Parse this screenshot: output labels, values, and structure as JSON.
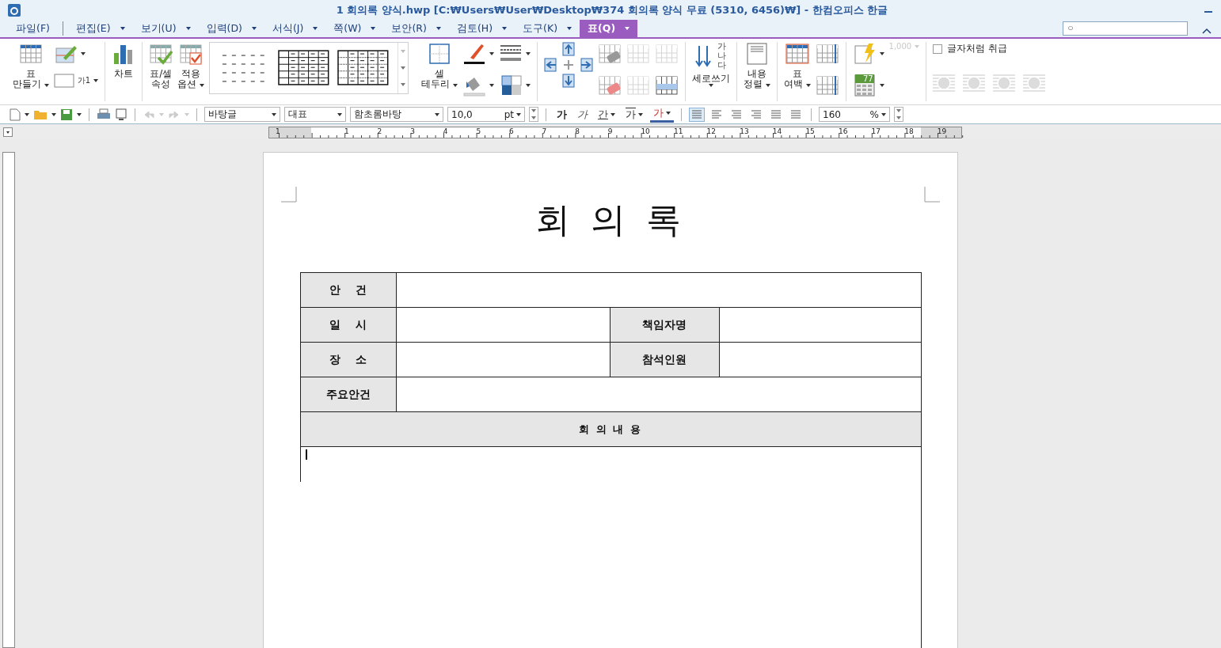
{
  "window": {
    "title": "1 회의록 양식.hwp [C:₩Users₩User₩Desktop₩374 회의록 양식 무료 (5310, 6456)₩] - 한컴오피스 한글"
  },
  "menu": [
    {
      "label": "파일(F)",
      "selected": false,
      "dropdown": false
    },
    {
      "label": "편집(E)",
      "selected": false,
      "dropdown": true
    },
    {
      "label": "보기(U)",
      "selected": false,
      "dropdown": true
    },
    {
      "label": "입력(D)",
      "selected": false,
      "dropdown": true
    },
    {
      "label": "서식(J)",
      "selected": false,
      "dropdown": true
    },
    {
      "label": "쪽(W)",
      "selected": false,
      "dropdown": true
    },
    {
      "label": "보안(R)",
      "selected": false,
      "dropdown": true
    },
    {
      "label": "검토(H)",
      "selected": false,
      "dropdown": true
    },
    {
      "label": "도구(K)",
      "selected": false,
      "dropdown": true
    },
    {
      "label": "표(Q)",
      "selected": true,
      "dropdown": true
    }
  ],
  "search": {
    "value": "ㅇ"
  },
  "ribbon": {
    "make_table": [
      "표",
      "만들기"
    ],
    "caption_box": "가1",
    "chart": [
      "차트"
    ],
    "cell_props": [
      "표/셀",
      "속성"
    ],
    "apply_options": [
      "적용",
      "옵션"
    ],
    "cell_border": [
      "셀",
      "테두리"
    ],
    "vertical_writing": [
      "세로쓰기"
    ],
    "vertical_icon_text": "가나다",
    "content_align": [
      "내용",
      "정렬"
    ],
    "table_margin": [
      "표",
      "여백"
    ],
    "number_format": {
      "label": "1,000",
      "disabled": true
    },
    "calc_icon_text": "77",
    "treat_as_char": {
      "label": "글자처럼 취급",
      "checked": false
    }
  },
  "toolbar": {
    "style": "바탕글",
    "style_kind": "대표",
    "font": "함초롬바탕",
    "size": "10,0",
    "unit": "pt",
    "char_buttons": [
      {
        "label": "가",
        "kind": "bold"
      },
      {
        "label": "가",
        "kind": "italic"
      },
      {
        "label": "간",
        "kind": "underline"
      },
      {
        "label": "가",
        "kind": "outline"
      },
      {
        "label": "가",
        "kind": "color"
      }
    ],
    "align_buttons": [
      {
        "selected": true
      },
      {
        "selected": false
      },
      {
        "selected": false
      },
      {
        "selected": false
      },
      {
        "selected": false
      },
      {
        "selected": false
      }
    ],
    "line_spacing": "160",
    "line_spacing_unit": "%"
  },
  "ruler": {
    "labels": [
      "1",
      "1",
      "2",
      "3",
      "4",
      "5",
      "6",
      "7",
      "8",
      "9",
      "10",
      "11",
      "12",
      "13",
      "14",
      "15",
      "16",
      "17",
      "18",
      "19"
    ]
  },
  "document": {
    "title": "회 의 록",
    "rows": [
      [
        {
          "kind": "label",
          "text": "안    건"
        },
        {
          "kind": "value"
        }
      ],
      [
        {
          "kind": "label",
          "text": "일    시"
        },
        {
          "kind": "value"
        },
        {
          "kind": "label",
          "text": "책임자명"
        },
        {
          "kind": "value"
        }
      ],
      [
        {
          "kind": "label",
          "text": "장    소"
        },
        {
          "kind": "value"
        },
        {
          "kind": "label",
          "text": "참석인원"
        },
        {
          "kind": "value"
        }
      ],
      [
        {
          "kind": "label",
          "text": "주요안건"
        },
        {
          "kind": "value"
        }
      ],
      [
        {
          "kind": "header",
          "text": "회 의 내 용"
        }
      ],
      [
        {
          "kind": "content",
          "cursor": true
        }
      ]
    ]
  }
}
